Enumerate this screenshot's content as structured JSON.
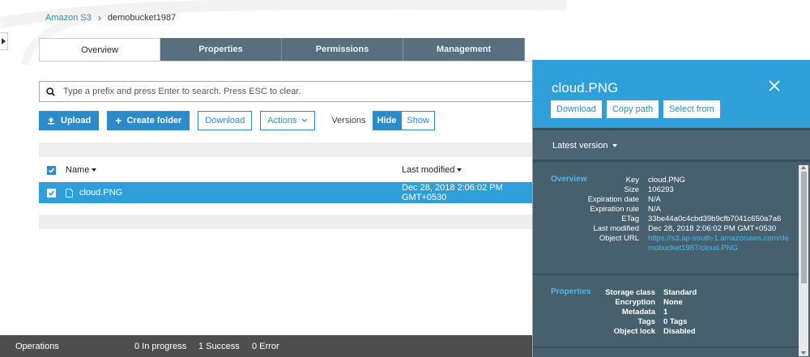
{
  "breadcrumb": {
    "root": "Amazon S3",
    "separator": "›",
    "current": "demobucket1987"
  },
  "tabs": [
    {
      "label": "Overview",
      "active": true
    },
    {
      "label": "Properties",
      "active": false
    },
    {
      "label": "Permissions",
      "active": false
    },
    {
      "label": "Management",
      "active": false
    }
  ],
  "search": {
    "placeholder": "Type a prefix and press Enter to search. Press ESC to clear.",
    "icon": "search-icon"
  },
  "toolbar": {
    "upload": "Upload",
    "create_folder": "Create folder",
    "download": "Download",
    "actions": "Actions",
    "versions_label": "Versions",
    "hide": "Hide",
    "show": "Show"
  },
  "table": {
    "col_name": "Name",
    "col_modified": "Last modified",
    "rows": [
      {
        "name": "cloud.PNG",
        "modified": "Dec 28, 2018 2:06:02 PM GMT+0530",
        "selected": true
      }
    ]
  },
  "status": {
    "operations": "Operations",
    "in_progress": "0 In progress",
    "success": "1 Success",
    "error": "0 Error"
  },
  "panel": {
    "title": "cloud.PNG",
    "buttons": [
      "Download",
      "Copy path",
      "Select from"
    ],
    "version": "Latest version",
    "overview": {
      "label": "Overview",
      "key_label": "Key",
      "key": "cloud.PNG",
      "size_label": "Size",
      "size": "106293",
      "exp_date_label": "Expiration date",
      "exp_date": "N/A",
      "exp_rule_label": "Expiration rule",
      "exp_rule": "N/A",
      "etag_label": "ETag",
      "etag": "33be44a0c4cbd39b9cfb7041c650a7a6",
      "modified_label": "Last modified",
      "modified": "Dec 28, 2018 2:06:02 PM GMT+0530",
      "url_label": "Object URL",
      "url": "https://s3.ap-south-1.amazonaws.com/demobucket1987/cloud.PNG"
    },
    "properties": {
      "label": "Properties",
      "storage_label": "Storage class",
      "storage": "Standard",
      "encryption_label": "Encryption",
      "encryption": "None",
      "metadata_label": "Metadata",
      "metadata": "1",
      "tags_label": "Tags",
      "tags": "0 Tags",
      "lock_label": "Object lock",
      "lock": "Disabled"
    }
  },
  "colors": {
    "accent": "#2e8bc9",
    "selected_row": "#2e9fd8",
    "tab_bg": "#586f7f",
    "panel_bg": "#46606e",
    "status_bar": "#4e4e4e",
    "link": "#4fb8ee"
  }
}
